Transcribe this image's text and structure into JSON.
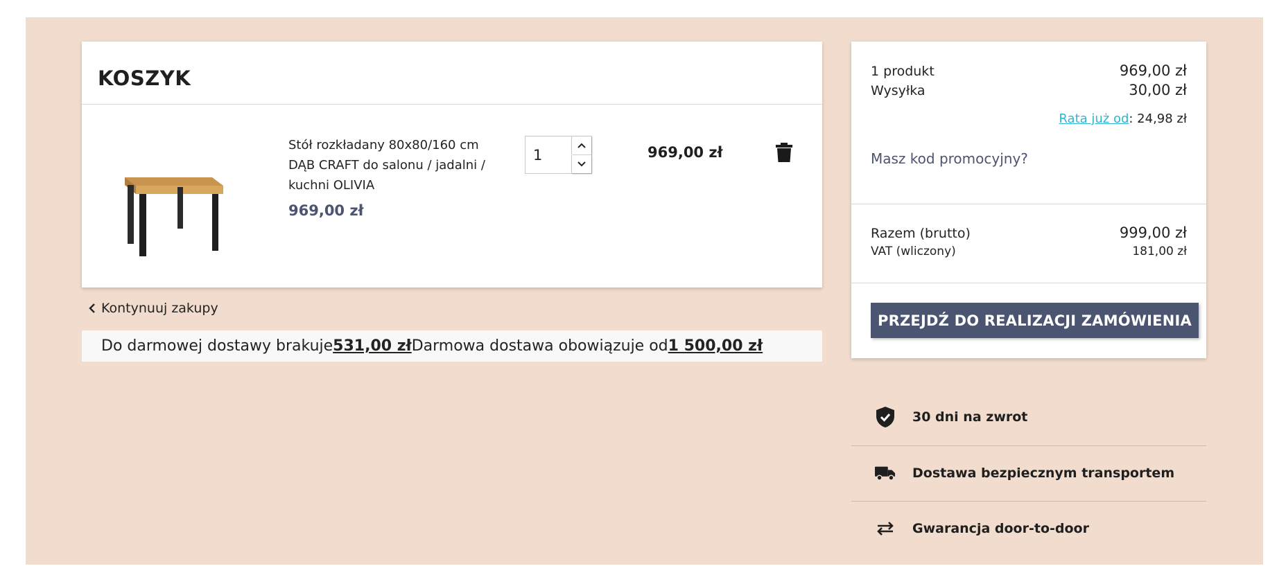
{
  "cart": {
    "title": "KOSZYK",
    "item": {
      "name": "Stół rozkładany 80x80/160 cm DĄB CRAFT do salonu / jadalni / kuchni OLIVIA",
      "unit_price": "969,00 zł",
      "quantity": "1",
      "line_total": "969,00 zł"
    },
    "continue_label": "Kontynuuj zakupy",
    "free_shipping": {
      "prefix": "Do darmowej dostawy brakuje ",
      "missing": "531,00 zł ",
      "middle": "Darmowa dostawa obowiązuje od ",
      "threshold": "1 500,00 zł"
    }
  },
  "summary": {
    "products_label": "1 produkt",
    "products_value": "969,00 zł",
    "shipping_label": "Wysyłka",
    "shipping_value": "30,00 zł",
    "installment_link": "Rata już od",
    "installment_value": ": 24,98 zł",
    "promo_label": "Masz kod promocyjny?",
    "total_label": "Razem (brutto)",
    "total_value": "999,00 zł",
    "vat_label": "VAT (wliczony)",
    "vat_value": "181,00 zł",
    "checkout_label": "PRZEJDŹ DO REALIZACJI ZAMÓWIENIA"
  },
  "reassurance": [
    {
      "icon": "shield-check-icon",
      "text": "30 dni na zwrot"
    },
    {
      "icon": "truck-icon",
      "text": "Dostawa bezpiecznym transportem"
    },
    {
      "icon": "swap-arrows-icon",
      "text": "Gwarancja door-to-door"
    }
  ],
  "colors": {
    "page_background": "#f1dccd",
    "accent": "#4b5470",
    "link": "#2fb5d2"
  }
}
